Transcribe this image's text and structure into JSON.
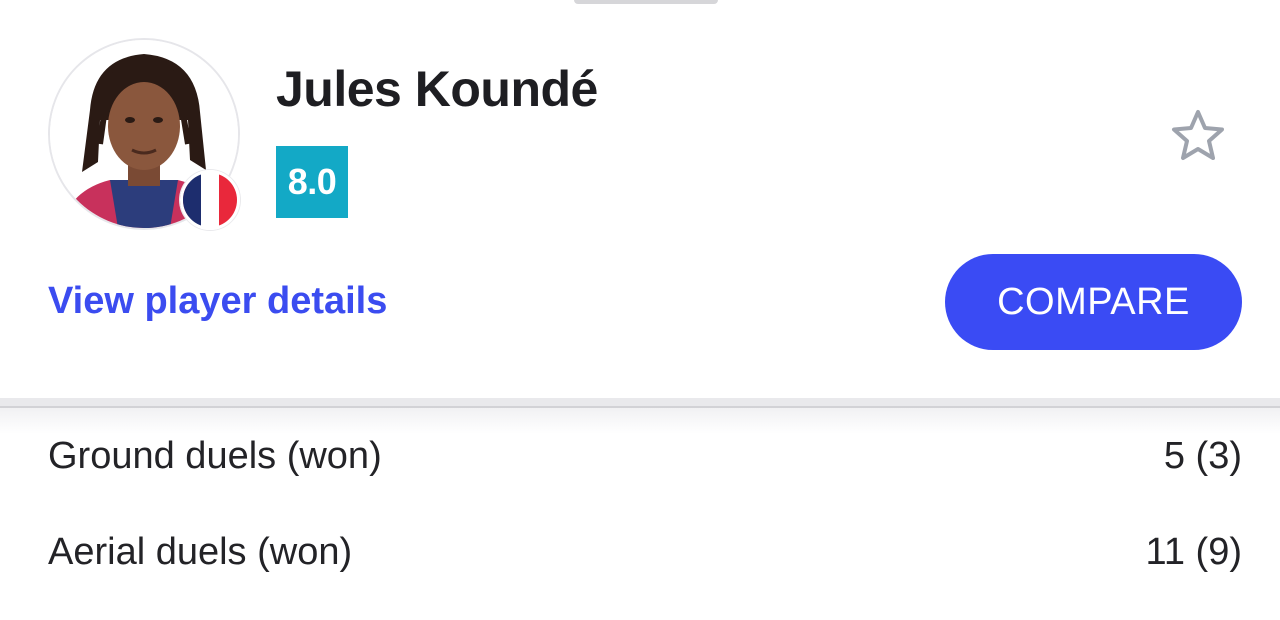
{
  "player": {
    "name": "Jules Koundé",
    "rating": "8.0",
    "nationality_flag": "france-flag-icon"
  },
  "actions": {
    "details_link": "View player details",
    "compare_label": "COMPARE",
    "favorite_icon": "star-outline-icon"
  },
  "stats": [
    {
      "label": "Ground duels (won)",
      "value": "5 (3)"
    },
    {
      "label": "Aerial duels (won)",
      "value": "11 (9)"
    }
  ],
  "colors": {
    "accent": "#3a4bf4",
    "link": "#3b4cf0",
    "rating_bg": "#13a9c6",
    "text": "#222226"
  }
}
